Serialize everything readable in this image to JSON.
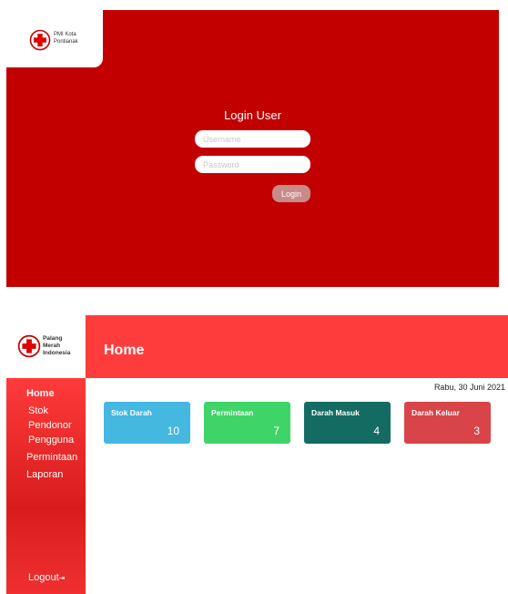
{
  "login": {
    "logo": {
      "line1": "PMI Kota",
      "line2": "Pontianak"
    },
    "title": "Login User",
    "username_placeholder": "Username",
    "password_placeholder": "Password",
    "login_button": "Login"
  },
  "dashboard": {
    "logo": {
      "line1": "Palang",
      "line2": "Merah",
      "line3": "Indonesia"
    },
    "header_title": "Home",
    "date": "Rabu, 30 Juni 2021",
    "nav": {
      "items": [
        "Home",
        "Stok",
        "Pendonor",
        "Pengguna",
        "Permintaan",
        "Laporan"
      ],
      "logout": "Logout"
    },
    "cards": [
      {
        "title": "Stok Darah",
        "value": "10",
        "color": "#44b8e0"
      },
      {
        "title": "Permintaan",
        "value": "7",
        "color": "#3fd468"
      },
      {
        "title": "Darah Masuk",
        "value": "4",
        "color": "#146b62"
      },
      {
        "title": "Darah Keluar",
        "value": "3",
        "color": "#d94449"
      }
    ]
  },
  "colors": {
    "login_background": "#c20000",
    "header_red": "#ff3c3c",
    "sidebar_red": "#e02424"
  },
  "icons": {
    "logo": "red-cross-icon",
    "logout": "logout-icon"
  }
}
